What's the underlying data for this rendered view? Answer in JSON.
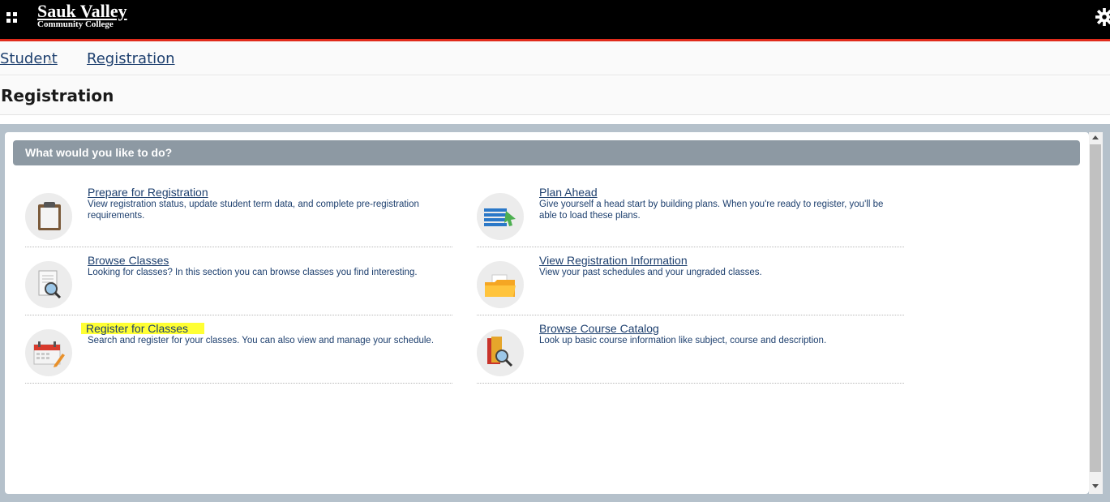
{
  "header": {
    "logo_main": "Sauk Valley",
    "logo_sub": "Community College",
    "apps_icon": "grid-icon",
    "settings_icon": "gear-icon"
  },
  "breadcrumb": {
    "items": [
      "Student",
      "Registration"
    ]
  },
  "page": {
    "title": "Registration"
  },
  "panel": {
    "header": "What would you like to do?",
    "cards": [
      {
        "title": "Prepare for Registration",
        "description": "View registration status, update student term data, and complete pre-registration requirements.",
        "icon": "clipboard-icon"
      },
      {
        "title": "Plan Ahead",
        "description": "Give yourself a head start by building plans. When you're ready to register, you'll be able to load these plans.",
        "icon": "plan-list-icon"
      },
      {
        "title": "Browse Classes",
        "description": "Looking for classes? In this section you can browse classes you find interesting.",
        "icon": "document-search-icon"
      },
      {
        "title": "View Registration Information",
        "description": "View your past schedules and your ungraded classes.",
        "icon": "folder-icon"
      },
      {
        "title": "Register for Classes",
        "description": "Search and register for your classes. You can also view and manage your schedule.",
        "icon": "calendar-edit-icon",
        "highlighted": true
      },
      {
        "title": "Browse Course Catalog",
        "description": "Look up basic course information like subject, course and description.",
        "icon": "book-search-icon"
      }
    ]
  },
  "colors": {
    "header_bg": "#000000",
    "accent": "#e02b1b",
    "link": "#1d3f6e",
    "panel_header": "#8d99a3",
    "highlight": "#ffff33"
  }
}
